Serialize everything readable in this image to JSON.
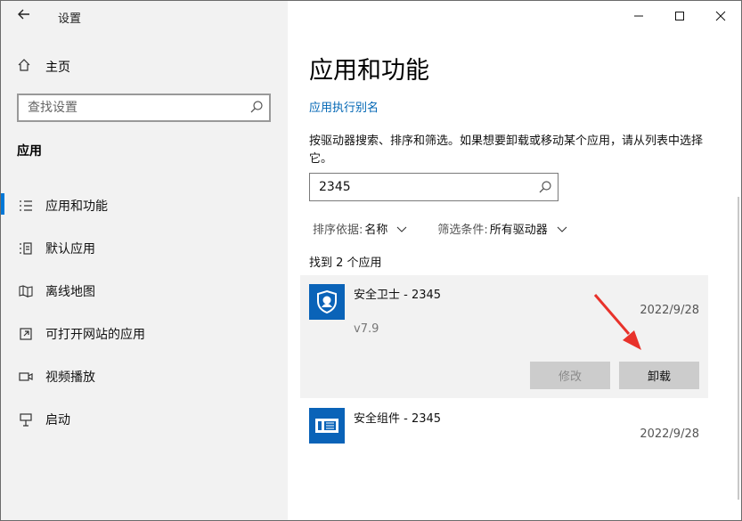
{
  "window": {
    "title": "设置",
    "back_icon": "back-arrow-icon",
    "caption": {
      "minimize": "minimize-icon",
      "maximize": "maximize-icon",
      "close": "close-icon"
    }
  },
  "sidebar": {
    "home_label": "主页",
    "search_placeholder": "查找设置",
    "section_title": "应用",
    "items": [
      {
        "label": "应用和功能",
        "icon": "apps-list-icon",
        "active": true
      },
      {
        "label": "默认应用",
        "icon": "default-apps-icon",
        "active": false
      },
      {
        "label": "离线地图",
        "icon": "offline-map-icon",
        "active": false
      },
      {
        "label": "可打开网站的应用",
        "icon": "open-website-icon",
        "active": false
      },
      {
        "label": "视频播放",
        "icon": "video-icon",
        "active": false
      },
      {
        "label": "启动",
        "icon": "startup-icon",
        "active": false
      }
    ]
  },
  "main": {
    "title": "应用和功能",
    "alias_link": "应用执行别名",
    "description": "按驱动器搜索、排序和筛选。如果想要卸载或移动某个应用，请从列表中选择它。",
    "search_value": "2345",
    "sort_label": "排序依据:",
    "sort_value": "名称",
    "filter_label": "筛选条件:",
    "filter_value": "所有驱动器",
    "found_text": "找到 2 个应用",
    "apps": [
      {
        "name": "安全卫士 - 2345",
        "date": "2022/9/28",
        "version": "v7.9",
        "modify_label": "修改",
        "uninstall_label": "卸载"
      },
      {
        "name": "安全组件 - 2345",
        "date": "2022/9/28"
      }
    ]
  },
  "colors": {
    "accent": "#0078d7",
    "link": "#0066b4",
    "app_icon_bg": "#0a63b8",
    "annotation_arrow": "#e8322b"
  }
}
